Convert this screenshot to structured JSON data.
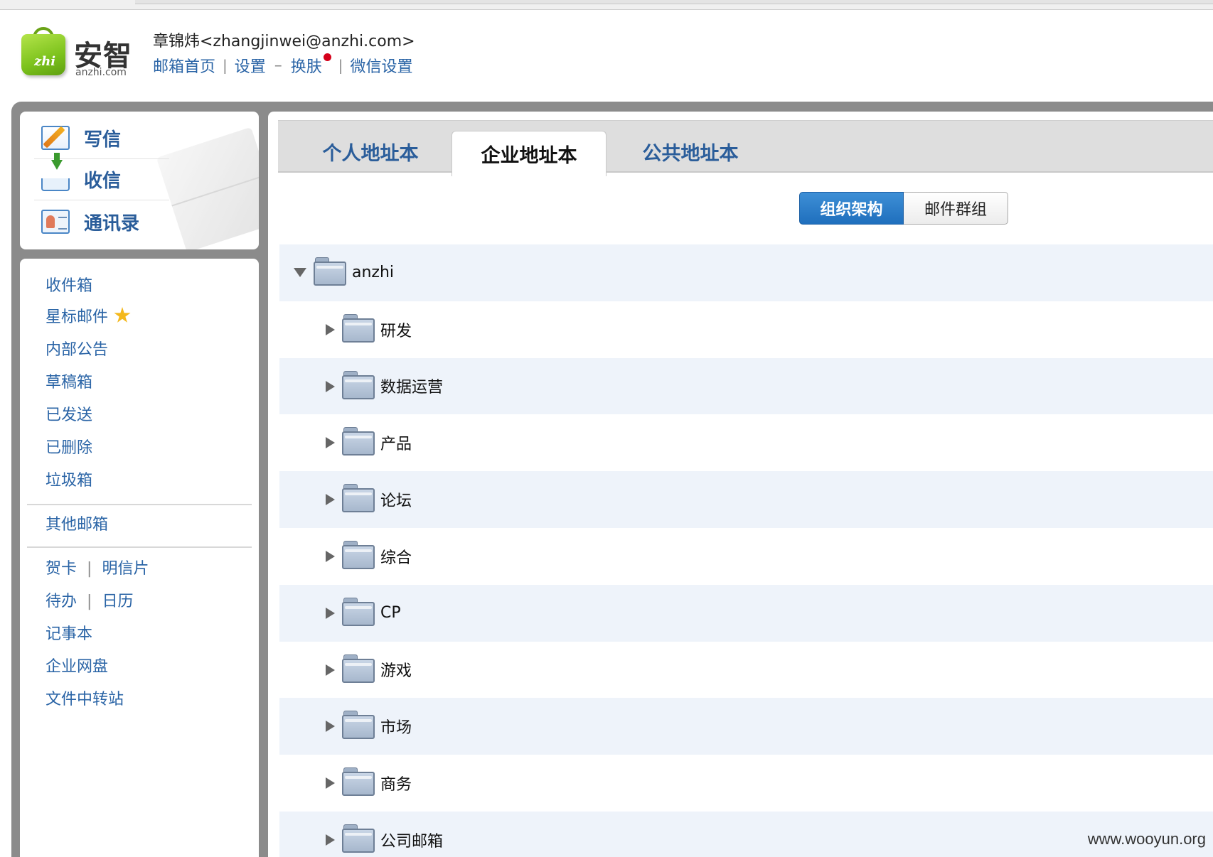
{
  "logo": {
    "cn": "安智",
    "en": "anzhi.com",
    "mark": "zhi"
  },
  "header": {
    "user": "章锦炜<zhangjinwei@anzhi.com>",
    "links": {
      "home": "邮箱首页",
      "settings": "设置",
      "skin": "换肤",
      "wechat": "微信设置",
      "dash": "–",
      "pipe": "|"
    }
  },
  "compose": {
    "write": "写信",
    "receive": "收信",
    "contacts": "通讯录"
  },
  "folders": {
    "inbox": "收件箱",
    "starred": "星标邮件",
    "notice": "内部公告",
    "drafts": "草稿箱",
    "sent": "已发送",
    "deleted": "已删除",
    "spam": "垃圾箱",
    "other": "其他邮箱",
    "card": "贺卡",
    "postcard": "明信片",
    "todo": "待办",
    "calendar": "日历",
    "notes": "记事本",
    "disk": "企业网盘",
    "transfer": "文件中转站",
    "pipe": "|"
  },
  "tabs": {
    "personal": "个人地址本",
    "company": "企业地址本",
    "public": "公共地址本"
  },
  "view_toggle": {
    "org": "组织架构",
    "groups": "邮件群组"
  },
  "tree": {
    "root": "anzhi",
    "children": [
      "研发",
      "数据运营",
      "产品",
      "论坛",
      "综合",
      "CP",
      "游戏",
      "市场",
      "商务",
      "公司邮箱"
    ]
  },
  "watermark": "www.wooyun.org",
  "colors": {
    "link": "#2a64a6",
    "accent": "#1f6fbd",
    "frame": "#8b8b8b",
    "row_shade": "#eef3fa"
  }
}
